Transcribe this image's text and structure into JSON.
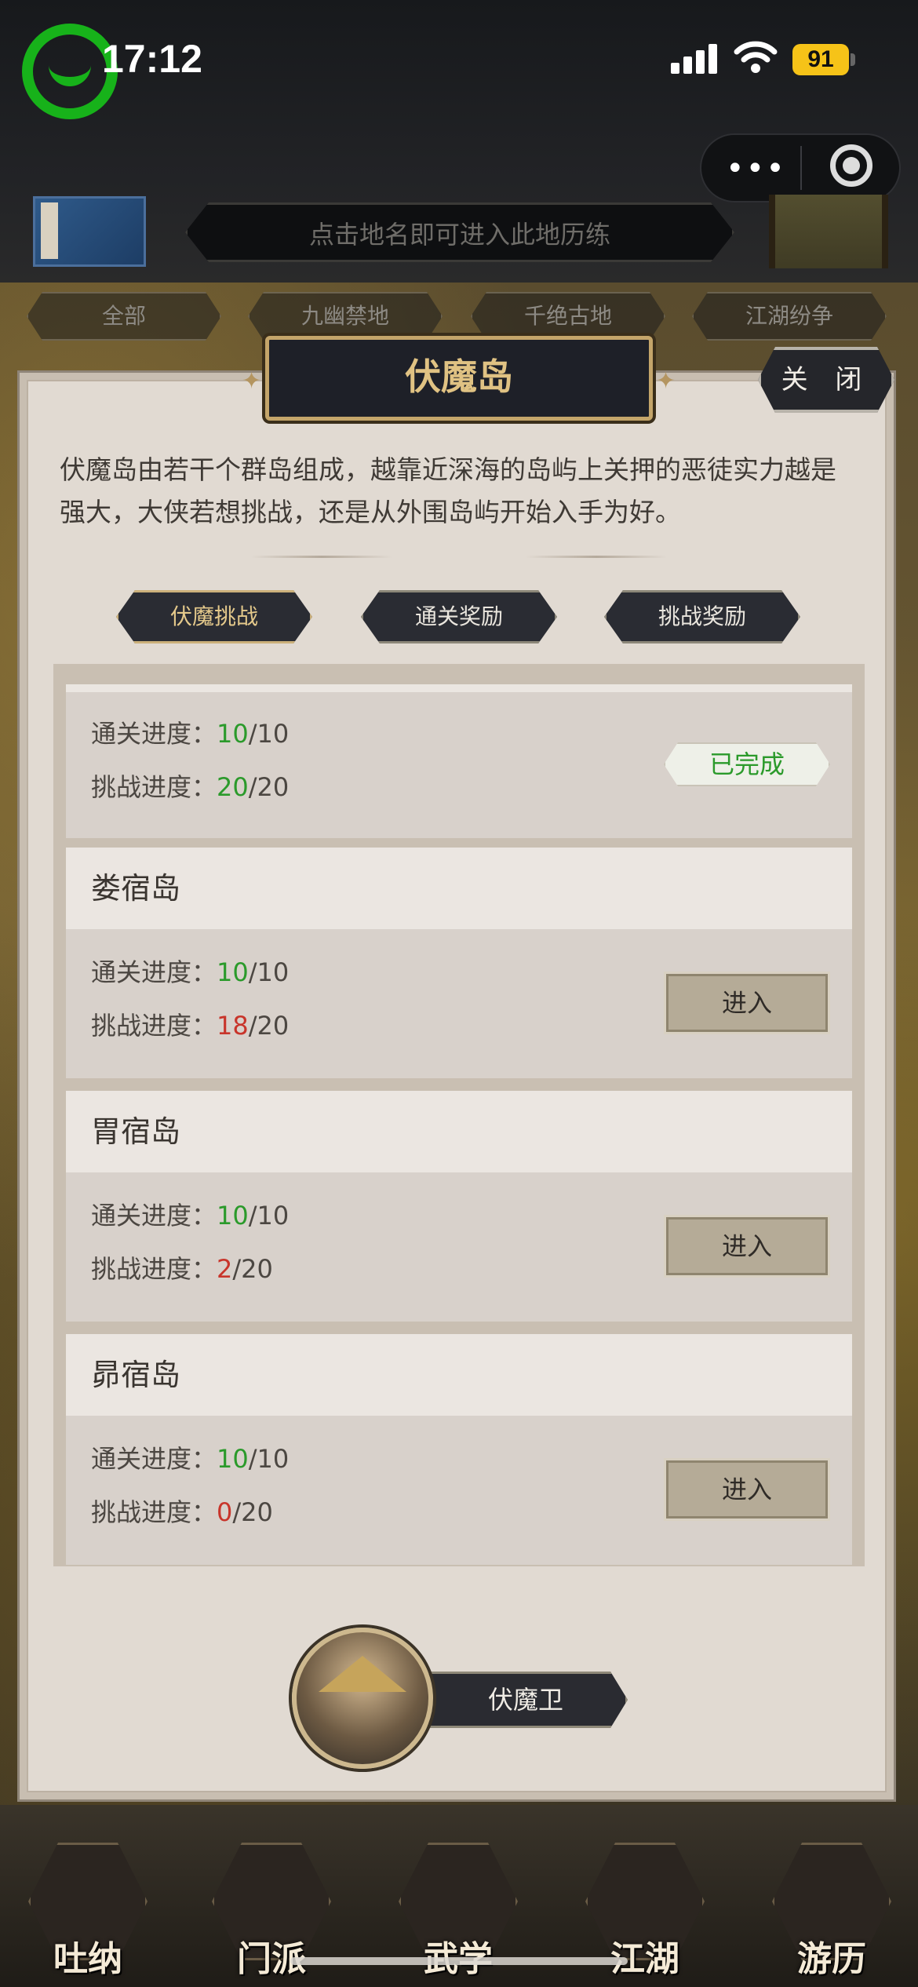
{
  "status_bar": {
    "time": "17:12",
    "battery": "91"
  },
  "header": {
    "hint": "点击地名即可进入此地历练",
    "filter_tabs": [
      "全部",
      "九幽禁地",
      "千绝古地",
      "江湖纷争"
    ]
  },
  "panel": {
    "title": "伏魔岛",
    "close_label": "关 闭",
    "description": "伏魔岛由若干个群岛组成，越靠近深海的岛屿上关押的恶徒实力越是强大，大侠若想挑战，还是从外围岛屿开始入手为好。",
    "tabs": [
      {
        "label": "伏魔挑战",
        "active": true
      },
      {
        "label": "通关奖励",
        "active": false
      },
      {
        "label": "挑战奖励",
        "active": false
      }
    ]
  },
  "islands": [
    {
      "name": "",
      "clear_label": "通关进度：",
      "clear_done": "10",
      "clear_total": "/10",
      "challenge_label": "挑战进度：",
      "challenge_done": "20",
      "challenge_total": "/20",
      "status": "已完成"
    },
    {
      "name": "娄宿岛",
      "clear_label": "通关进度：",
      "clear_done": "10",
      "clear_total": "/10",
      "challenge_label": "挑战进度：",
      "challenge_done": "18",
      "challenge_total": "/20",
      "action": "进入"
    },
    {
      "name": "胃宿岛",
      "clear_label": "通关进度：",
      "clear_done": "10",
      "clear_total": "/10",
      "challenge_label": "挑战进度：",
      "challenge_done": "2",
      "challenge_total": "/20",
      "action": "进入"
    },
    {
      "name": "昴宿岛",
      "clear_label": "通关进度：",
      "clear_done": "10",
      "clear_total": "/10",
      "challenge_label": "挑战进度：",
      "challenge_done": "0",
      "challenge_total": "/20",
      "action": "进入"
    }
  ],
  "npc": {
    "name": "伏魔卫"
  },
  "bottom_nav": [
    "吐纳",
    "门派",
    "武学",
    "江湖",
    "游历"
  ],
  "colors": {
    "accent_gold": "#e0c283",
    "progress_ok": "#2b9a2b",
    "progress_incomplete": "#c8352b"
  }
}
